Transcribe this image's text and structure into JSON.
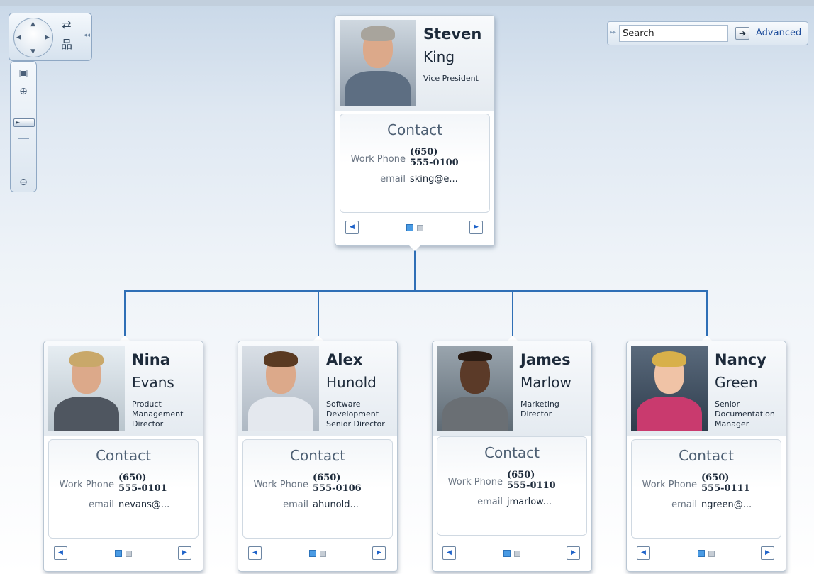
{
  "controls": {
    "nav_up": "▲",
    "nav_down": "▼",
    "nav_left": "◀",
    "nav_right": "▶",
    "refresh_icon": "⇄",
    "hierarchy_icon": "品",
    "fit_icon": "▣",
    "zoom_in_icon": "⊕",
    "zoom_out_icon": "⊖",
    "collapse_icon": "◂◂",
    "slider_thumb": "►",
    "zoom_level": 0.55
  },
  "search": {
    "placeholder": "Search",
    "value": "Search",
    "go_icon": "➔",
    "advanced_label": "Advanced"
  },
  "root": {
    "first_name": "Steven",
    "last_name": "King",
    "title": "Vice President",
    "contact_heading": "Contact",
    "work_phone_label": "Work Phone",
    "work_phone": "(650)\n555-0100",
    "email_label": "email",
    "email": "sking@e...",
    "prev_icon": "◀",
    "next_icon": "▶"
  },
  "children": [
    {
      "first_name": "Nina",
      "last_name": "Evans",
      "title": "Product\nManagement\nDirector",
      "contact_heading": "Contact",
      "work_phone_label": "Work Phone",
      "work_phone": "(650)\n555-0101",
      "email_label": "email",
      "email": "nevans@...",
      "prev_icon": "◀",
      "next_icon": "▶"
    },
    {
      "first_name": "Alex",
      "last_name": "Hunold",
      "title": "Software\nDevelopment\nSenior Director",
      "contact_heading": "Contact",
      "work_phone_label": "Work Phone",
      "work_phone": "(650)\n555-0106",
      "email_label": "email",
      "email": "ahunold...",
      "prev_icon": "◀",
      "next_icon": "▶"
    },
    {
      "first_name": "James",
      "last_name": "Marlow",
      "title": "Marketing\nDirector",
      "contact_heading": "Contact",
      "work_phone_label": "Work Phone",
      "work_phone": "(650)\n555-0110",
      "email_label": "email",
      "email": "jmarlow...",
      "prev_icon": "◀",
      "next_icon": "▶"
    },
    {
      "first_name": "Nancy",
      "last_name": "Green",
      "title": "Senior\nDocumentation\nManager",
      "contact_heading": "Contact",
      "work_phone_label": "Work Phone",
      "work_phone": "(650)\n555-0111",
      "email_label": "email",
      "email": "ngreen@...",
      "prev_icon": "◀",
      "next_icon": "▶"
    }
  ],
  "colors": {
    "connector": "#2f6fb6",
    "accent": "#4a9be4",
    "link": "#1f4e9c"
  }
}
